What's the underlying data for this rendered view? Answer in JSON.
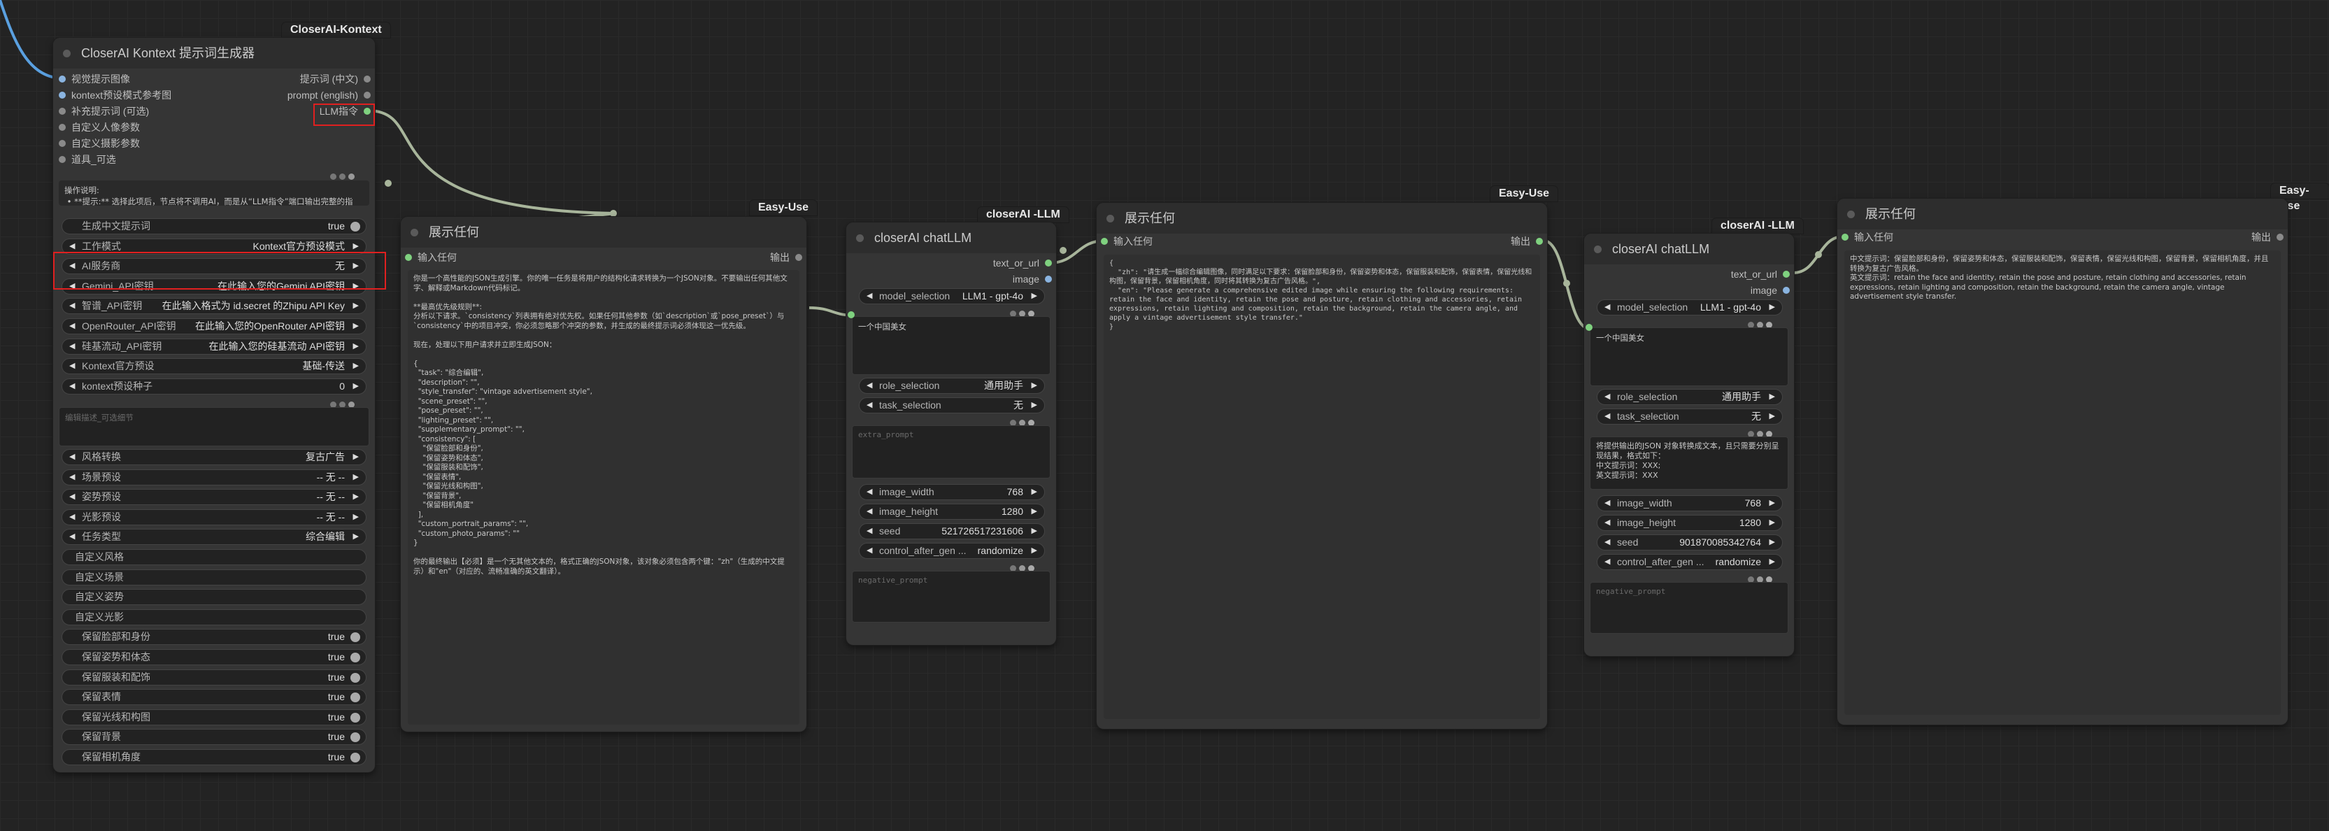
{
  "colors": {
    "canvas": "#232323",
    "node": "#353535",
    "title": "#2d2d2d",
    "wire": "#a8b59b",
    "wire_blue": "#5aa0e0",
    "input_green": "#7fd17f",
    "highlight": "#e02020"
  },
  "badges": [
    "CloserAI-Kontext",
    "Easy-Use",
    "closerAI -LLM",
    "Easy-Use",
    "closerAI -LLM",
    "Easy-Use"
  ],
  "node1": {
    "title": "CloserAI Kontext 提示词生成器",
    "inputs": [
      "视觉提示图像",
      "kontext预设模式参考图",
      "补充提示词 (可选)",
      "自定义人像参数",
      "自定义摄影参数",
      "道具_可选"
    ],
    "outputs": [
      "提示词 (中文)",
      "prompt (english)",
      "LLM指令"
    ],
    "instructions": "操作说明:\n • **提示:** 选择此项后，节点将不调用AI，而是从“LLM指令”端口输出完整的指令，供您连接到其他LLM节点使用。",
    "widgets1": [
      {
        "type": "toggle",
        "label": "生成中文提示词",
        "value": "true"
      },
      {
        "type": "combo",
        "label": "工作模式",
        "value": "Kontext官方预设模式"
      },
      {
        "type": "combo",
        "label": "AI服务商",
        "value": "无"
      },
      {
        "type": "combo",
        "label": "Gemini_API密钥",
        "value": "在此输入您的Gemini API密钥"
      },
      {
        "type": "combo",
        "label": "智谱_API密钥",
        "value": "在此输入格式为 id.secret 的Zhipu API Key"
      },
      {
        "type": "combo",
        "label": "OpenRouter_API密钥",
        "value": "在此输入您的OpenRouter API密钥"
      },
      {
        "type": "combo",
        "label": "硅基流动_API密钥",
        "value": "在此输入您的硅基流动 API密钥"
      },
      {
        "type": "combo",
        "label": "Kontext官方预设",
        "value": "基础-传送"
      },
      {
        "type": "combo",
        "label": "kontext预设种子",
        "value": "0"
      }
    ],
    "edit_placeholder": "编辑描述_可选细节",
    "widgets2": [
      {
        "type": "combo",
        "label": "风格转换",
        "value": "复古广告"
      },
      {
        "type": "combo",
        "label": "场景预设",
        "value": "-- 无 --"
      },
      {
        "type": "combo",
        "label": "姿势预设",
        "value": "-- 无 --"
      },
      {
        "type": "combo",
        "label": "光影预设",
        "value": "-- 无 --"
      },
      {
        "type": "combo",
        "label": "任务类型",
        "value": "综合编辑"
      },
      {
        "type": "button",
        "label": "自定义风格",
        "value": ""
      },
      {
        "type": "button",
        "label": "自定义场景",
        "value": ""
      },
      {
        "type": "button",
        "label": "自定义姿势",
        "value": ""
      },
      {
        "type": "button",
        "label": "自定义光影",
        "value": ""
      },
      {
        "type": "toggle",
        "label": "保留脸部和身份",
        "value": "true"
      },
      {
        "type": "toggle",
        "label": "保留姿势和体态",
        "value": "true"
      },
      {
        "type": "toggle",
        "label": "保留服装和配饰",
        "value": "true"
      },
      {
        "type": "toggle",
        "label": "保留表情",
        "value": "true"
      },
      {
        "type": "toggle",
        "label": "保留光线和构图",
        "value": "true"
      },
      {
        "type": "toggle",
        "label": "保留背景",
        "value": "true"
      },
      {
        "type": "toggle",
        "label": "保留相机角度",
        "value": "true"
      }
    ]
  },
  "node2": {
    "title": "展示任何",
    "input": "输入任何",
    "output": "输出",
    "text": "你是一个高性能的JSON生成引擎。你的唯一任务是将用户的结构化请求转换为一个JSON对象。不要输出任何其他文字、解释或Markdown代码标记。\n\n**最高优先级规则**:\n分析以下请求。`consistency`列表拥有绝对优先权。如果任何其他参数（如`description`或`pose_preset`）与`consistency`中的项目冲突，你必须忽略那个冲突的参数，并生成的最终提示词必须体现这一优先级。\n\n现在，处理以下用户请求并立即生成JSON：\n\n{\n  \"task\": \"综合编辑\",\n  \"description\": \"\",\n  \"style_transfer\": \"vintage advertisement style\",\n  \"scene_preset\": \"\",\n  \"pose_preset\": \"\",\n  \"lighting_preset\": \"\",\n  \"supplementary_prompt\": \"\",\n  \"consistency\": [\n    \"保留脸部和身份\",\n    \"保留姿势和体态\",\n    \"保留服装和配饰\",\n    \"保留表情\",\n    \"保留光线和构图\",\n    \"保留背景\",\n    \"保留相机角度\"\n  ],\n  \"custom_portrait_params\": \"\",\n  \"custom_photo_params\": \"\"\n}\n\n你的最终输出【必须】是一个无其他文本的，格式正确的JSON对象，该对象必须包含两个键：\"zh\"（生成的中文提示）和\"en\"（对应的、流畅准确的英文翻译）。"
  },
  "llm1": {
    "title": "closerAI chatLLM",
    "outputs": [
      "text_or_url",
      "image"
    ],
    "model_label": "model_selection",
    "model_value": "LLM1 - gpt-4o",
    "prompt_text": "一个中国美女",
    "role_label": "role_selection",
    "role_value": "通用助手",
    "task_label": "task_selection",
    "task_value": "无",
    "extra_placeholder": "extra_prompt",
    "width_label": "image_width",
    "width_value": "768",
    "height_label": "image_height",
    "height_value": "1280",
    "seed_label": "seed",
    "seed_value": "521726517231606",
    "cag_label": "control_after_gen ...",
    "cag_value": "randomize",
    "neg_placeholder": "negative_prompt"
  },
  "node3": {
    "title": "展示任何",
    "input": "输入任何",
    "output": "输出",
    "text": "{\n  \"zh\": \"请生成一幅综合编辑图像，同时满足以下要求：保留脸部和身份，保留姿势和体态，保留服装和配饰，保留表情，保留光线和构图，保留背景，保留相机角度，同时将其转换为复古广告风格。\",\n  \"en\": \"Please generate a comprehensive edited image while ensuring the following requirements: retain the face and identity, retain the pose and posture, retain clothing and accessories, retain expressions, retain lighting and composition, retain the background, retain the camera angle, and apply a vintage advertisement style transfer.\"\n}"
  },
  "llm2": {
    "title": "closerAI chatLLM",
    "outputs": [
      "text_or_url",
      "image"
    ],
    "model_label": "model_selection",
    "model_value": "LLM1 - gpt-4o",
    "prompt_text": "一个中国美女",
    "role_label": "role_selection",
    "role_value": "通用助手",
    "task_label": "task_selection",
    "task_value": "无",
    "extra_text": "将提供输出的JSON 对象转换成文本，且只需要分别呈现结果，格式如下：\n中文提示词：XXX;\n英文提示词：XXX",
    "width_label": "image_width",
    "width_value": "768",
    "height_label": "image_height",
    "height_value": "1280",
    "seed_label": "seed",
    "seed_value": "901870085342764",
    "cag_label": "control_after_gen ...",
    "cag_value": "randomize",
    "neg_placeholder": "negative_prompt"
  },
  "node4": {
    "title": "展示任何",
    "input": "输入任何",
    "output": "输出",
    "text": "中文提示词：保留脸部和身份，保留姿势和体态，保留服装和配饰，保留表情，保留光线和构图，保留背景，保留相机角度，并且转换为复古广告风格。\n英文提示词：retain the face and identity, retain the pose and posture, retain clothing and accessories, retain expressions, retain lighting and composition, retain the background, retain the camera angle, vintage advertisement style transfer."
  }
}
